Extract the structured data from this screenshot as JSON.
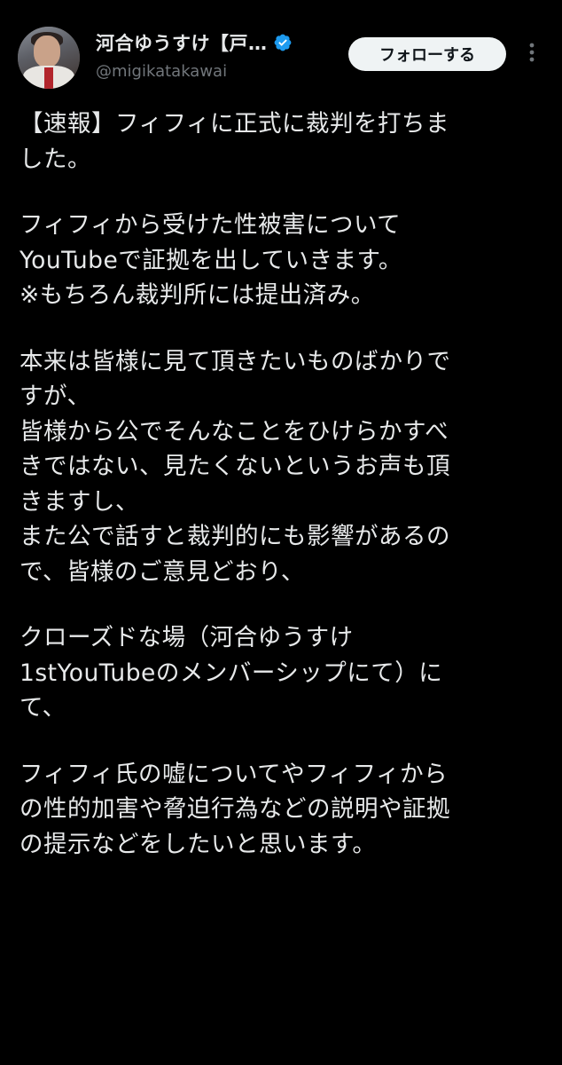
{
  "author": {
    "display_name": "河合ゆうすけ【戸…",
    "handle": "@migikatakawai"
  },
  "follow_button_label": "フォローする",
  "tweet": {
    "paragraphs": [
      [
        "【速報】フィフィに正式に裁判を打ちま",
        "した。"
      ],
      [
        "フィフィから受けた性被害について",
        "YouTubeで証拠を出していきます。",
        "※もちろん裁判所には提出済み。"
      ],
      [
        "本来は皆様に見て頂きたいものばかりで",
        "すが、",
        "皆様から公でそんなことをひけらかすべ",
        "きではない、見たくないというお声も頂",
        "きますし、",
        "また公で話すと裁判的にも影響があるの",
        "で、皆様のご意見どおり、"
      ],
      [
        "クローズドな場（河合ゆうすけ",
        "1stYouTubeのメンバーシップにて）に",
        "て、"
      ],
      [
        "フィフィ氏の嘘についてやフィフィから",
        "の性的加害や脅迫行為などの説明や証拠",
        "の提示などをしたいと思います。"
      ]
    ]
  },
  "colors": {
    "background": "#000000",
    "text_primary": "#e7e9ea",
    "text_secondary": "#71767b",
    "verified_blue": "#1d9bf0",
    "follow_bg": "#eff3f4"
  }
}
